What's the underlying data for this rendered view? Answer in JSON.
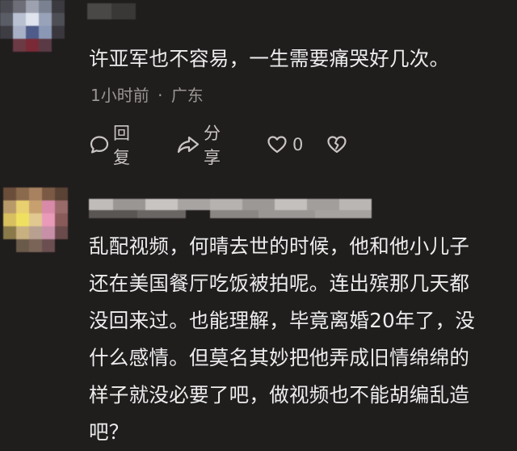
{
  "comments": [
    {
      "text": "许亚军也不容易，一生需要痛哭好几次。",
      "time": "1小时前",
      "separator": "·",
      "location": "广东",
      "actions": {
        "reply_label": "回复",
        "share_label": "分享",
        "like_count": "0"
      }
    },
    {
      "text_lines": [
        "乱配视频，何晴去世的时候，他和他小儿子",
        "还在美国餐厅吃饭被拍呢。连出殡那几天都",
        "没回来过。也能理解，毕竟离婚20年了，没",
        "什么感情。但莫名其妙把他弄成旧情绵绵的",
        "样子就没必要了吧，做视频也不能胡编乱造",
        "吧？"
      ]
    }
  ],
  "colors": {
    "background": "#201d1d",
    "text": "#ededed",
    "meta": "#9a9694",
    "icon": "#c9c5c3"
  },
  "icons": [
    "comment-bubble-icon",
    "share-arrow-icon",
    "heart-icon",
    "broken-heart-icon"
  ]
}
